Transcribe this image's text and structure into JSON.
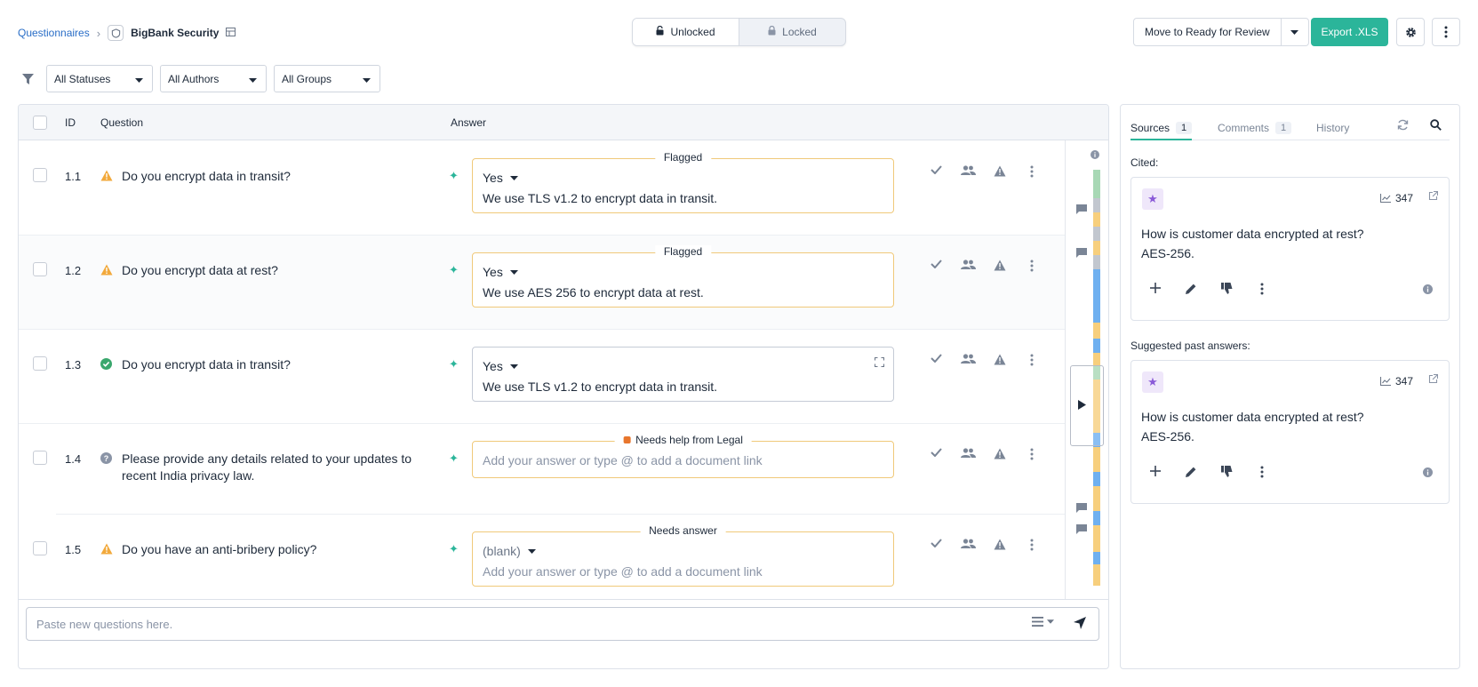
{
  "breadcrumb": {
    "root": "Questionnaires",
    "title": "BigBank Security"
  },
  "lock_toggle": {
    "unlocked": "Unlocked",
    "locked": "Locked"
  },
  "actions": {
    "move": "Move to Ready for Review",
    "export": "Export .XLS"
  },
  "filters": {
    "statuses": "All Statuses",
    "authors": "All Authors",
    "groups": "All Groups"
  },
  "table": {
    "headers": {
      "id": "ID",
      "question": "Question",
      "answer": "Answer"
    },
    "rows": [
      {
        "id": "1.1",
        "status": "warning",
        "question": "Do you encrypt data in transit?",
        "flag": "Flagged",
        "choice": "Yes",
        "answer": "We use TLS v1.2 to encrypt data in transit."
      },
      {
        "id": "1.2",
        "status": "warning",
        "question": "Do you encrypt data at rest?",
        "flag": "Flagged",
        "choice": "Yes",
        "answer": "We use AES 256 to encrypt data at rest."
      },
      {
        "id": "1.3",
        "status": "complete",
        "question": "Do you encrypt data in transit?",
        "choice": "Yes",
        "answer": "We use TLS v1.2 to encrypt data in transit."
      },
      {
        "id": "1.4",
        "status": "help",
        "question": "Please provide any details related to your updates to recent India privacy law.",
        "flag": "Needs help from Legal",
        "placeholder": "Add your answer or type @ to add a document link"
      },
      {
        "id": "1.5",
        "status": "warning",
        "question": "Do you have an anti-bribery policy?",
        "flag": "Needs answer",
        "choice": "(blank)",
        "placeholder": "Add your answer or type @ to add a document link"
      }
    ],
    "paste_placeholder": "Paste new questions here."
  },
  "sidebar": {
    "tabs": [
      {
        "label": "Sources",
        "count": "1"
      },
      {
        "label": "Comments",
        "count": "1"
      },
      {
        "label": "History"
      }
    ],
    "cited_label": "Cited:",
    "suggested_label": "Suggested past answers:",
    "cards": [
      {
        "uses": "347",
        "question": "How is customer data encrypted at rest?",
        "answer": "AES-256."
      },
      {
        "uses": "347",
        "question": "How is customer data encrypted at rest?",
        "answer": "AES-256."
      }
    ]
  },
  "colors": {
    "accent": "#2bb59a",
    "warning": "#f2a93b",
    "flag_border": "#f0c97a",
    "complete": "#3aa76d",
    "legal": "#e8762d"
  },
  "icons": [
    "chevron-right-icon",
    "shield-icon",
    "table-icon",
    "lock-icon",
    "caret-down-icon",
    "gear-icon",
    "more-vertical-icon",
    "filter-icon",
    "sparkle-icon",
    "check-icon",
    "users-icon",
    "warning-icon",
    "expand-icon",
    "info-icon",
    "comment-icon",
    "play-icon",
    "list-icon",
    "send-icon",
    "refresh-icon",
    "search-icon",
    "star-icon",
    "trend-icon",
    "external-link-icon",
    "plus-icon",
    "pencil-icon",
    "thumbs-down-icon"
  ]
}
